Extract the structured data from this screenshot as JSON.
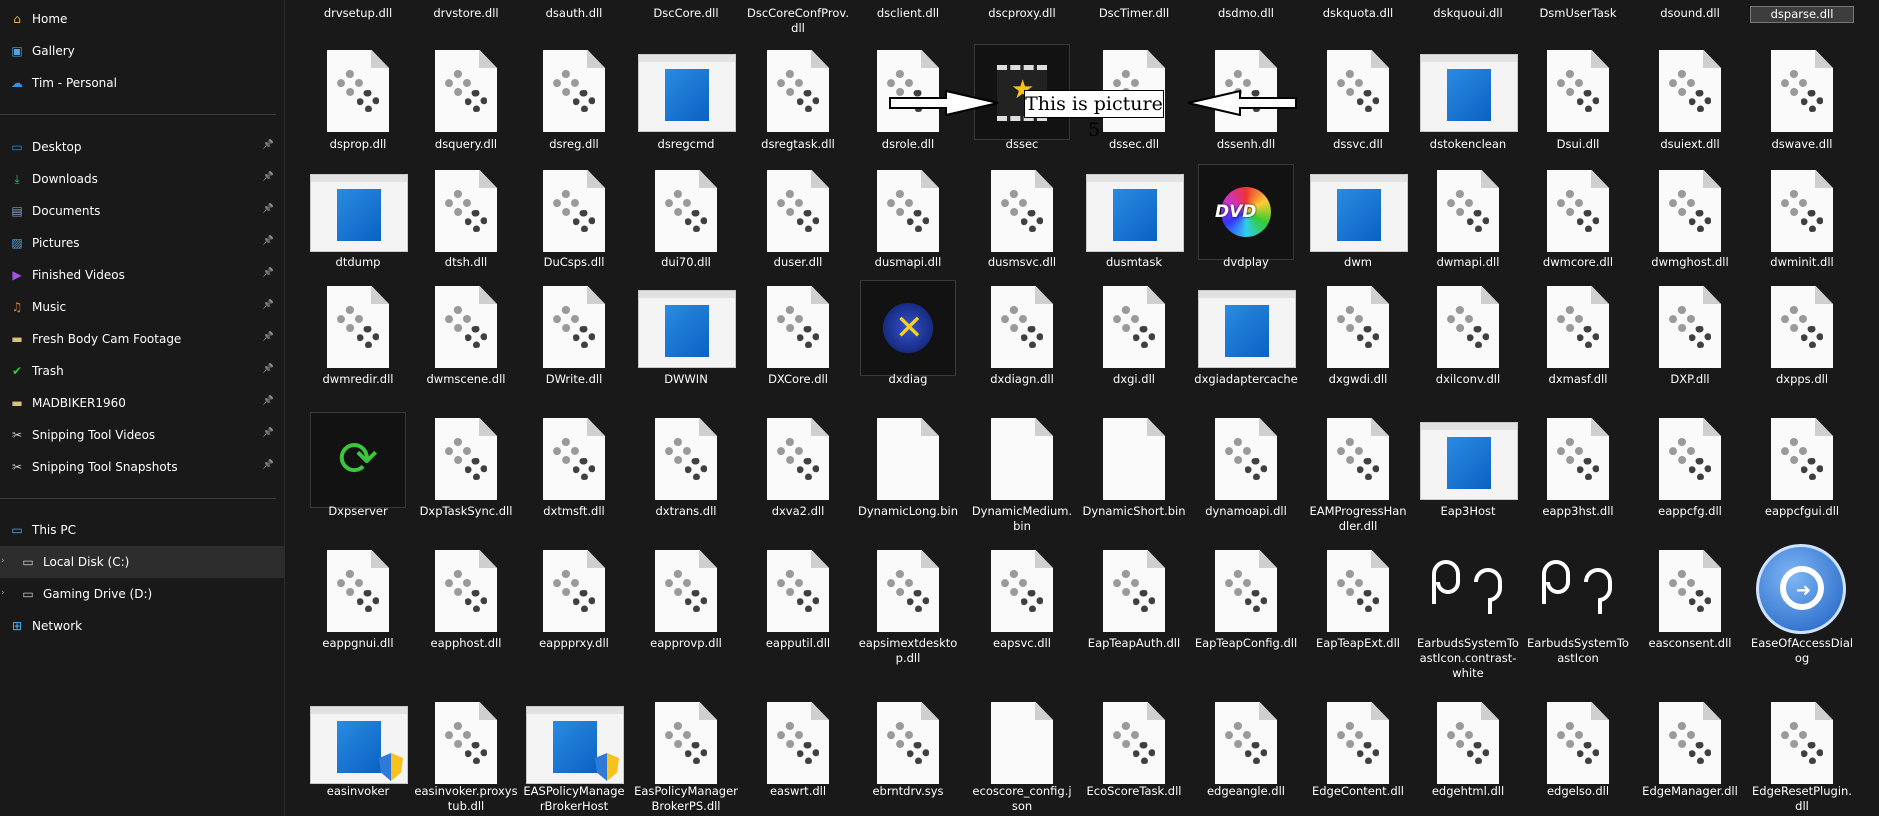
{
  "sidebar": {
    "top": [
      {
        "label": "Home",
        "icon": "home-icon"
      },
      {
        "label": "Gallery",
        "icon": "gallery-icon"
      },
      {
        "label": "Tim - Personal",
        "icon": "cloud-icon"
      }
    ],
    "quick": [
      {
        "label": "Desktop",
        "icon": "desktop-icon"
      },
      {
        "label": "Downloads",
        "icon": "downloads-icon"
      },
      {
        "label": "Documents",
        "icon": "documents-icon"
      },
      {
        "label": "Pictures",
        "icon": "pictures-icon"
      },
      {
        "label": "Finished Videos",
        "icon": "videos-icon"
      },
      {
        "label": "Music",
        "icon": "music-icon"
      },
      {
        "label": "Fresh Body Cam Footage",
        "icon": "folder-icon"
      },
      {
        "label": "Trash",
        "icon": "trash-check-icon"
      },
      {
        "label": "MADBIKER1960",
        "icon": "folder-icon"
      },
      {
        "label": "Snipping Tool Videos",
        "icon": "scissors-icon"
      },
      {
        "label": "Snipping Tool Snapshots",
        "icon": "scissors-icon"
      }
    ],
    "pc": [
      {
        "label": "This PC",
        "icon": "computer-icon"
      },
      {
        "label": "Local Disk (C:)",
        "icon": "disk-icon"
      },
      {
        "label": "Gaming Drive (D:)",
        "icon": "disk-icon"
      },
      {
        "label": "Network",
        "icon": "network-icon"
      }
    ]
  },
  "overlay": {
    "text": "This is picture 5"
  },
  "rows": [
    [
      "drvsetup.dll",
      "drvstore.dll",
      "dsauth.dll",
      "DscCore.dll",
      "DscCoreConfProv.dll",
      "dsclient.dll",
      "dscproxy.dll",
      "DscTimer.dll",
      "dsdmo.dll",
      "dskquota.dll",
      "dskquoui.dll",
      "DsmUserTask",
      "dsound.dll",
      "dsparse.dll"
    ],
    [
      "dsprop.dll",
      "dsquery.dll",
      "dsreg.dll",
      "dsregcmd",
      "dsregtask.dll",
      "dsrole.dll",
      "dssec",
      "dssec.dll",
      "dssenh.dll",
      "dssvc.dll",
      "dstokenclean",
      "Dsui.dll",
      "dsuiext.dll",
      "dswave.dll"
    ],
    [
      "dtdump",
      "dtsh.dll",
      "DuCsps.dll",
      "dui70.dll",
      "duser.dll",
      "dusmapi.dll",
      "dusmsvc.dll",
      "dusmtask",
      "dvdplay",
      "dwm",
      "dwmapi.dll",
      "dwmcore.dll",
      "dwmghost.dll",
      "dwminit.dll"
    ],
    [
      "dwmredir.dll",
      "dwmscene.dll",
      "DWrite.dll",
      "DWWIN",
      "DXCore.dll",
      "dxdiag",
      "dxdiagn.dll",
      "dxgi.dll",
      "dxgiadaptercache",
      "dxgwdi.dll",
      "dxilconv.dll",
      "dxmasf.dll",
      "DXP.dll",
      "dxpps.dll"
    ],
    [
      "Dxpserver",
      "DxpTaskSync.dll",
      "dxtmsft.dll",
      "dxtrans.dll",
      "dxva2.dll",
      "DynamicLong.bin",
      "DynamicMedium.bin",
      "DynamicShort.bin",
      "dynamoapi.dll",
      "EAMProgressHandler.dll",
      "Eap3Host",
      "eapp3hst.dll",
      "eappcfg.dll",
      "eappcfgui.dll"
    ],
    [
      "eappgnui.dll",
      "eapphost.dll",
      "eappprxy.dll",
      "eapprovp.dll",
      "eapputil.dll",
      "eapsimextdesktop.dll",
      "eapsvc.dll",
      "EapTeapAuth.dll",
      "EapTeapConfig.dll",
      "EapTeapExt.dll",
      "EarbudsSystemToastIcon.contrast-white",
      "EarbudsSystemToastIcon",
      "easconsent.dll",
      "EaseOfAccessDialog"
    ],
    [
      "easinvoker",
      "easinvoker.proxystub.dll",
      "EASPolicyManagerBrokerHost",
      "EasPolicyManagerBrokerPS.dll",
      "easwrt.dll",
      "ebrntdrv.sys",
      "ecoscore_config.json",
      "EcoScoreTask.dll",
      "edgeangle.dll",
      "EdgeContent.dll",
      "edgehtml.dll",
      "edgelso.dll",
      "EdgeManager.dll",
      "EdgeResetPlugin.dll"
    ]
  ],
  "icons": [
    [
      "dll",
      "dll",
      "dll",
      "dll",
      "dll",
      "dll",
      "dll",
      "dll",
      "dll",
      "dll",
      "dll",
      "dll",
      "dll",
      "dll"
    ],
    [
      "dll",
      "dll",
      "dll",
      "window",
      "dll",
      "dll",
      "film",
      "dll",
      "dll",
      "dll",
      "window",
      "dll",
      "dll",
      "dll"
    ],
    [
      "window",
      "dll",
      "dll",
      "dll",
      "dll",
      "dll",
      "dll",
      "window",
      "dvd",
      "window",
      "dll",
      "dll",
      "dll",
      "dll"
    ],
    [
      "dll",
      "dll",
      "dll",
      "window",
      "dll",
      "dxdiag",
      "dll",
      "dll",
      "window",
      "dll",
      "dll",
      "dll",
      "dll",
      "dll"
    ],
    [
      "refresh",
      "dll",
      "dll",
      "dll",
      "dll",
      "blank",
      "blank",
      "blank",
      "dll",
      "dll",
      "window",
      "dll",
      "dll",
      "dll"
    ],
    [
      "dll",
      "dll",
      "dll",
      "dll",
      "dll",
      "dll",
      "dll",
      "dll",
      "dll",
      "dll",
      "earbuds",
      "earbuds",
      "dll",
      "ease"
    ],
    [
      "window-shield",
      "dll",
      "window-shield",
      "dll",
      "dll",
      "dll",
      "blank",
      "dll",
      "dll",
      "dll",
      "dll",
      "dll",
      "dll",
      "dll"
    ]
  ],
  "selected": "dsparse.dll"
}
